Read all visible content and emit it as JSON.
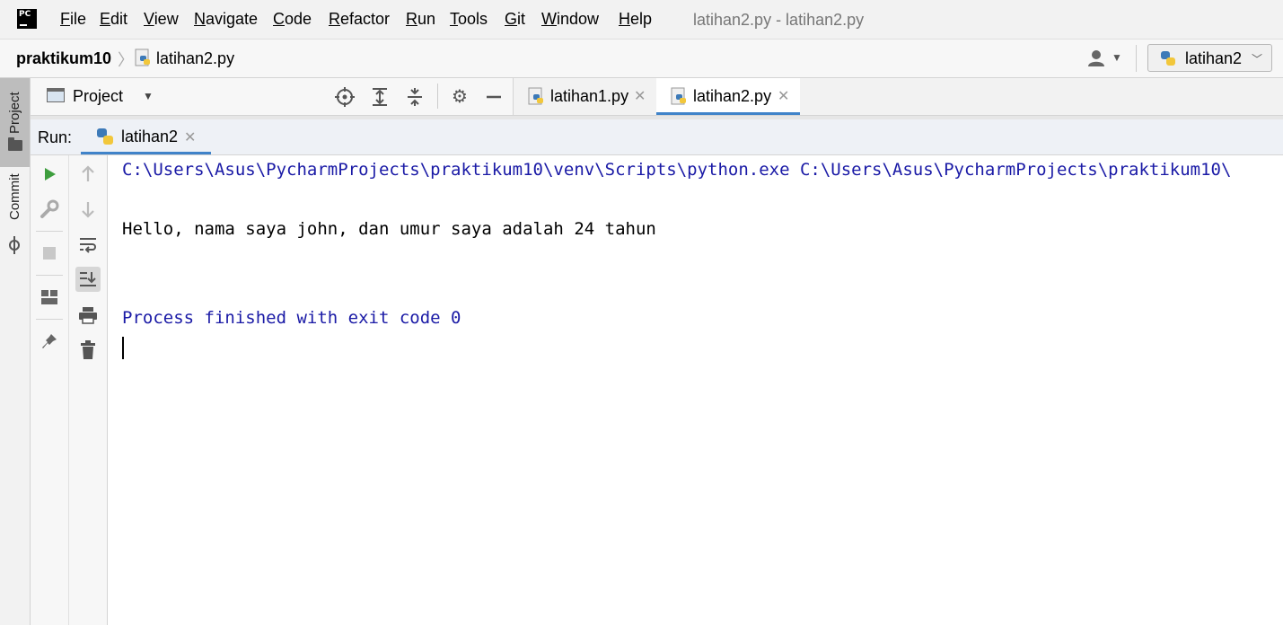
{
  "menubar": {
    "items": [
      "File",
      "Edit",
      "View",
      "Navigate",
      "Code",
      "Refactor",
      "Run",
      "Tools",
      "Git",
      "Window",
      "Help"
    ],
    "window_title": "latihan2.py - latihan2.py",
    "logo_text": "PC"
  },
  "navbar": {
    "project": "praktikum10",
    "file": "latihan2.py",
    "run_config": "latihan2"
  },
  "left_stripe": {
    "project_label": "Project",
    "commit_label": "Commit"
  },
  "project_panel": {
    "title": "Project"
  },
  "editor_tabs": [
    {
      "label": "latihan1.py",
      "active": false
    },
    {
      "label": "latihan2.py",
      "active": true
    }
  ],
  "run_window": {
    "label": "Run:",
    "tab": "latihan2"
  },
  "console": {
    "command_line": "C:\\Users\\Asus\\PycharmProjects\\praktikum10\\venv\\Scripts\\python.exe C:\\Users\\Asus\\PycharmProjects\\praktikum10\\",
    "output_line": "Hello, nama saya john, dan umur saya adalah 24 tahun",
    "exit_line": "Process finished with exit code 0"
  },
  "colors": {
    "accent": "#4083c9",
    "run_green": "#3e9e3e",
    "console_system_text": "#1a1aa6"
  }
}
